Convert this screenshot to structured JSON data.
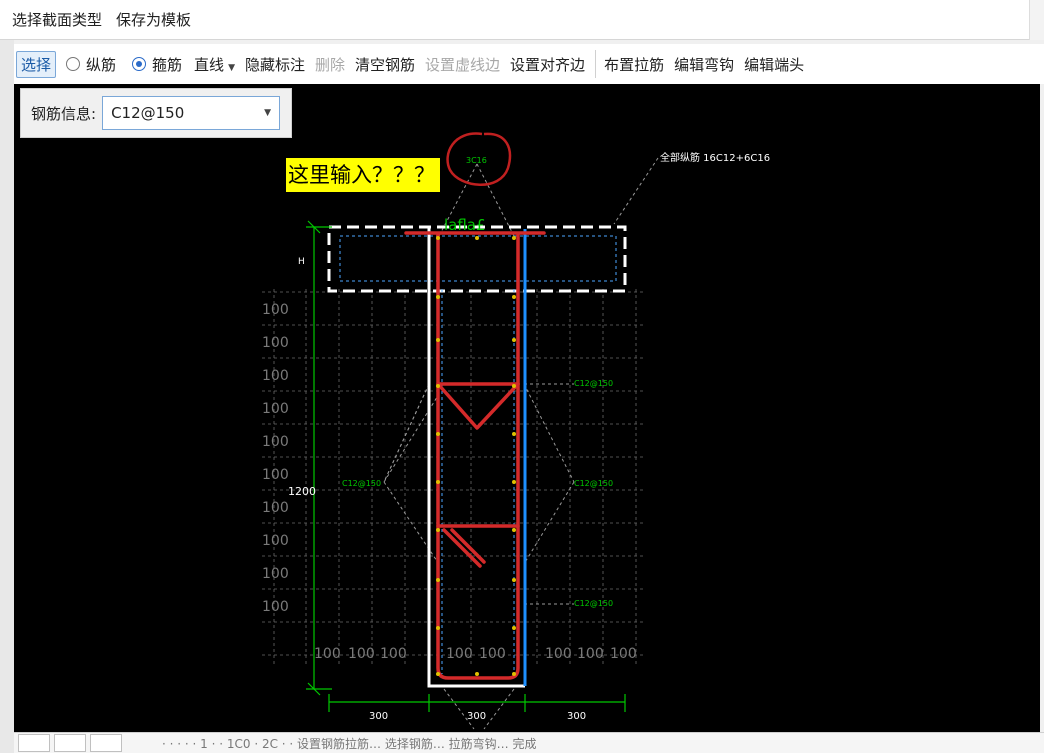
{
  "topbar": {
    "select_section_type": "选择截面类型",
    "save_template": "保存为模板"
  },
  "toolbar": {
    "select": "选择",
    "longitudinal": "纵筋",
    "stirrup": "箍筋",
    "stirrup_checked": true,
    "line": "直线",
    "hide_labels": "隐藏标注",
    "delete": "删除",
    "clear_rebar": "清空钢筋",
    "set_dashed_edge": "设置虚线边",
    "set_align_edge": "设置对齐边",
    "place_tie": "布置拉筋",
    "edit_hook": "编辑弯钩",
    "edit_end": "编辑端头"
  },
  "rebar_info": {
    "label": "钢筋信息:",
    "value": "C12@150"
  },
  "drawing": {
    "note": "这里输入？？？",
    "top_rebar": "3C16",
    "all_longitudinal": "全部纵筋   16C12+6C16",
    "flange_label": "lafla£",
    "h_label": "H",
    "height_dim": "1200",
    "left_stirrup": "C12@150",
    "right_stirrup_1": "C12@150",
    "right_stirrup_2": "C12@150",
    "right_stirrup_3": "C12@150",
    "grid_label": "100",
    "bottom_dims": [
      "300",
      "300",
      "300"
    ],
    "colors": {
      "background": "#000000",
      "rebar": "#d42a2a",
      "outline": "#ffffff",
      "dimension": "#00c800",
      "blue_edge": "#1e90ff",
      "marker": "#e0c000",
      "highlight": "#ffff00",
      "circle": "#c02020"
    }
  },
  "statusbar": {
    "text": "· · · · · 1 · · 1C0 · 2C · · 设置钢筋拉筋… 选择钢筋… 拉筋弯钩… 完成"
  }
}
